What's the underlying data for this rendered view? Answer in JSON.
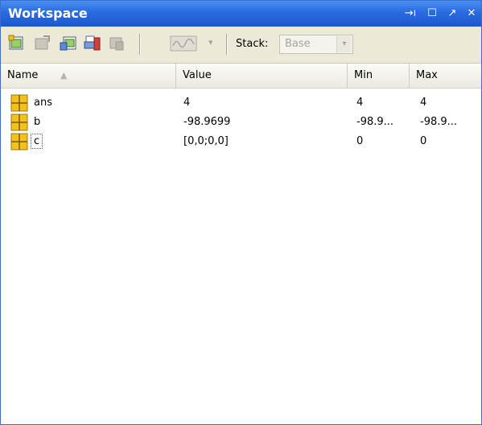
{
  "window": {
    "title": "Workspace",
    "controls": {
      "dock": "→ı",
      "maximize": "☐",
      "undock": "↗",
      "close": "✕"
    }
  },
  "toolbar": {
    "stack_label": "Stack:",
    "stack_value": "Base",
    "dropdown_arrow": "▾",
    "combo_arrow": "▾"
  },
  "table": {
    "columns": [
      {
        "label": "Name"
      },
      {
        "label": "Value"
      },
      {
        "label": "Min"
      },
      {
        "label": "Max"
      }
    ],
    "sort_indicator": "▲",
    "rows": [
      {
        "name": "ans",
        "value": "4",
        "min": "4",
        "max": "4"
      },
      {
        "name": "b",
        "value": "-98.9699",
        "min": "-98.9...",
        "max": "-98.9..."
      },
      {
        "name": "c",
        "value": "[0,0;0,0]",
        "min": "0",
        "max": "0"
      }
    ]
  },
  "colors": {
    "titlebar": "#2a6ae0",
    "toolbar": "#ece9d8",
    "icon_fill": "#f3c21a"
  }
}
